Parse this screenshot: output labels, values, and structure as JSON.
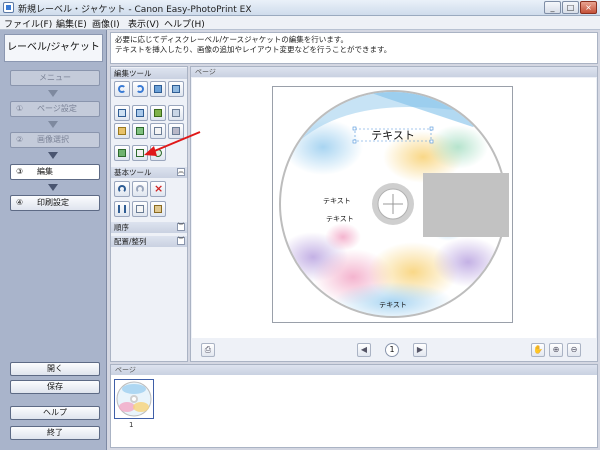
{
  "window": {
    "title": "新規レーベル・ジャケット - Canon Easy-PhotoPrint EX",
    "minimize": "_",
    "maximize": "□",
    "close": "×"
  },
  "menu": [
    "ファイル(F)",
    "編集(E)",
    "画像(I)",
    "表示(V)",
    "ヘルプ(H)"
  ],
  "sidebar": {
    "header": "レーベル/ジャケット",
    "steps": [
      {
        "num": "",
        "label": "メニュー"
      },
      {
        "num": "①",
        "label": "ページ設定"
      },
      {
        "num": "②",
        "label": "画像選択"
      },
      {
        "num": "③",
        "label": "編集"
      },
      {
        "num": "④",
        "label": "印刷設定"
      }
    ],
    "open_label": "開く",
    "save_label": "保存",
    "help_label": "ヘルプ",
    "exit_label": "終了"
  },
  "description": {
    "line1": "必要に応じてディスクレーベル/ケースジャケットの編集を行います。",
    "line2": "テキストを挿入したり、画像の追加やレイアウト変更などを行うことができます。"
  },
  "tools": {
    "edit_tools_label": "編集ツール",
    "basic_tools_label": "基本ツール",
    "order_label": "順序",
    "arrange_label": "配置/整列",
    "edit_icons": [
      "rotate-left-icon",
      "rotate-right-icon",
      "layout-icon",
      "image-icon",
      "frame-icon",
      "text-box-icon",
      "photo-icon",
      "background-icon",
      "resize-icon",
      "copy-image-icon",
      "settings-icon",
      "paint-icon",
      "add-text-icon",
      "text-edit-icon",
      "circle-text-icon"
    ],
    "basic_icons": [
      "undo-icon",
      "redo-icon",
      "delete-icon",
      "cut-icon",
      "copy-icon",
      "paste-icon"
    ]
  },
  "page": {
    "header": "ページ",
    "page_number": "1",
    "disc_texts": [
      "テキスト",
      "テキスト",
      "テキスト",
      "テキスト"
    ]
  },
  "thumbnails": {
    "header": "ページ",
    "items": [
      {
        "number": "1"
      }
    ]
  },
  "colors": {
    "accent": "#3f5fa8",
    "annotation_arrow": "#e01818",
    "disc_gray": "#bebebe"
  }
}
